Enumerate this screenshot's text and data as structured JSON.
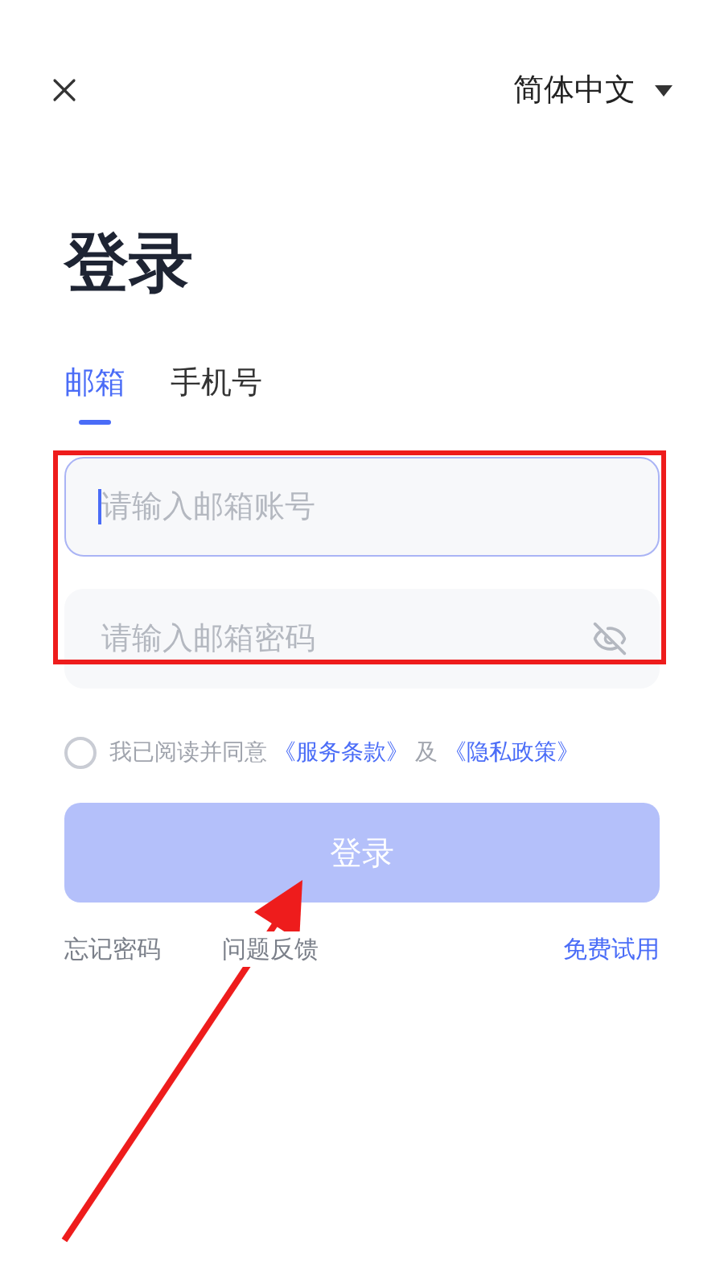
{
  "header": {
    "language": "简体中文"
  },
  "title": "登录",
  "tabs": [
    {
      "label": "邮箱",
      "selected": true
    },
    {
      "label": "手机号",
      "selected": false
    }
  ],
  "fields": [
    {
      "placeholder": "请输入邮箱账号",
      "focused": true,
      "kind": "text"
    },
    {
      "placeholder": "请输入邮箱密码",
      "focused": false,
      "kind": "password"
    }
  ],
  "agreement": {
    "checked": false,
    "text": "我已阅读并同意",
    "terms_link": "《服务条款》",
    "joiner": "及",
    "privacy_link": "《隐私政策》"
  },
  "login_button": {
    "label": "登录",
    "disabled": true
  },
  "footer_links": [
    {
      "label": "忘记密码",
      "kind": "plain"
    },
    {
      "label": "问题反馈",
      "kind": "plain"
    },
    {
      "label": "免费试用",
      "kind": "accent"
    }
  ]
}
